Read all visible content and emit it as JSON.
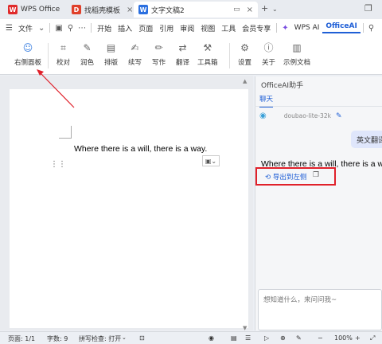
{
  "titlebar": {
    "tabs": [
      {
        "label": "WPS Office",
        "icon": "wps-logo-icon",
        "icon_color": "#e02a2a",
        "active": false
      },
      {
        "label": "找稻壳模板",
        "icon": "daoke-icon",
        "icon_color": "#e0402a",
        "active": false
      },
      {
        "label": "文字文稿2",
        "icon": "writer-doc-icon",
        "icon_color": "#2a6fe0",
        "active": true
      }
    ],
    "new_tab": "+"
  },
  "menubar": {
    "file_label": "文件",
    "items": [
      "开始",
      "插入",
      "页面",
      "引用",
      "审阅",
      "视图",
      "工具",
      "会员专享"
    ],
    "wps_ai": "WPS AI",
    "officeai": "OfficeAI"
  },
  "ribbon": {
    "buttons": [
      {
        "label": "右侧面板",
        "icon": "robot-icon"
      },
      {
        "label": "校对",
        "icon": "proofread-icon"
      },
      {
        "label": "润色",
        "icon": "polish-icon"
      },
      {
        "label": "排版",
        "icon": "layout-icon"
      },
      {
        "label": "续写",
        "icon": "continue-write-icon"
      },
      {
        "label": "写作",
        "icon": "write-icon"
      },
      {
        "label": "翻译",
        "icon": "translate-icon"
      },
      {
        "label": "工具箱",
        "icon": "toolbox-icon"
      },
      {
        "label": "设置",
        "icon": "settings-icon"
      },
      {
        "label": "关于",
        "icon": "info-icon"
      },
      {
        "label": "示例文档",
        "icon": "sample-doc-icon"
      }
    ]
  },
  "document": {
    "text": "Where there is a will, there is a way."
  },
  "panel": {
    "title": "OfficeAI助手",
    "tab": "聊天",
    "model": "doubao-lite-32k",
    "user_message": "英文翻译",
    "response": "Where there is a will, there is a way.",
    "export_label": "导出到左侧",
    "input_placeholder": "想知道什么，来问问我~"
  },
  "statusbar": {
    "page": "页面: 1/1",
    "words": "字数: 9",
    "spellcheck": "拼写检查: 打开",
    "zoom": "100%"
  },
  "colors": {
    "accent": "#1f5fd6",
    "annotation_red": "#e0202a"
  }
}
